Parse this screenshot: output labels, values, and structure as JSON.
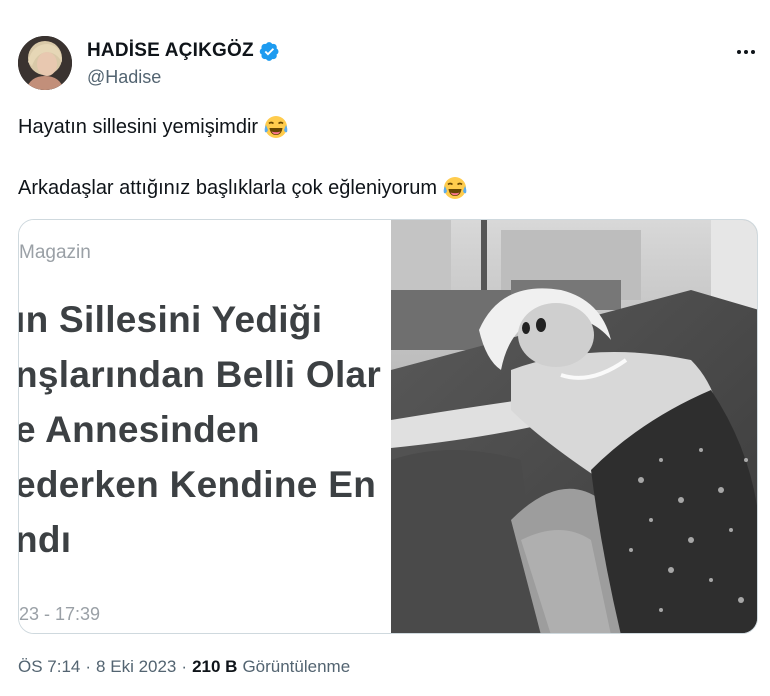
{
  "author": {
    "display_name": "HADİSE AÇIKGÖZ",
    "handle": "@Hadise",
    "verified": true
  },
  "tweet": {
    "lines": [
      "Hayatın sillesini yemişimdir",
      "Arkadaşlar attığınız başlıklarla çok eğleniyorum"
    ],
    "emoji": "face-with-tears-of-joy"
  },
  "card": {
    "category": "Magazin",
    "headline_lines": [
      "ın Sillesini Yediği",
      "nşlarından Belli Olar",
      "e Annesinden",
      "ederken Kendine En",
      "ndı"
    ],
    "timestamp": "23 - 17:39"
  },
  "meta": {
    "time": "ÖS 7:14",
    "date": "8 Eki 2023",
    "views_count": "210 B",
    "views_label": "Görüntülenme",
    "separator": "·"
  },
  "colors": {
    "verified_blue": "#1d9bf0",
    "text_primary": "#0f1419",
    "text_secondary": "#536471",
    "border": "#cfd9de"
  }
}
